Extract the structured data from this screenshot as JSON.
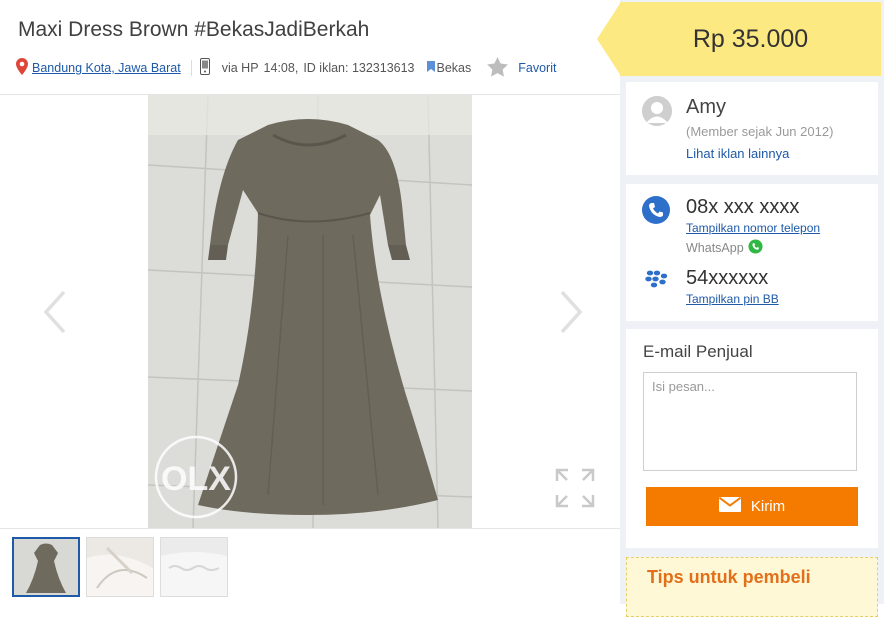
{
  "listing": {
    "title": "Maxi Dress Brown #BekasJadiBerkah",
    "location": "Bandung Kota, Jawa Barat",
    "via": "via HP",
    "time": "14:08,",
    "ad_id": "ID iklan: 132313613",
    "condition": "Bekas",
    "favorite_label": "Favorit"
  },
  "price": "Rp 35.000",
  "seller": {
    "name": "Amy",
    "member_since": "(Member sejak Jun 2012)",
    "other_ads_link": "Lihat iklan lainnya"
  },
  "contact": {
    "phone": "08x xxx xxxx",
    "show_phone": "Tampilkan nomor telepon",
    "whatsapp": "WhatsApp",
    "bb_pin": "54xxxxxx",
    "show_bb": "Tampilkan pin BB"
  },
  "email": {
    "title": "E-mail Penjual",
    "placeholder": "Isi pesan...",
    "value": "",
    "send_label": "Kirim"
  },
  "tips": {
    "title": "Tips untuk pembeli"
  },
  "gallery": {
    "watermark": "OLX",
    "thumbnail_count": 3,
    "active_index": 0
  },
  "colors": {
    "price_bg": "#fde981",
    "accent_blue": "#1e5aa8",
    "send_button": "#f47b00",
    "sidebar_bg": "#eef2f7",
    "tips_title": "#e2701b",
    "whatsapp_green": "#2fb843"
  },
  "icons": {
    "location": "map-pin-icon",
    "device": "mobile-phone-icon",
    "condition": "bookmark-icon",
    "favorite": "star-icon",
    "prev": "chevron-left-icon",
    "next": "chevron-right-icon",
    "fullscreen": "expand-icon",
    "phone": "phone-icon",
    "whatsapp": "whatsapp-icon",
    "blackberry": "blackberry-icon",
    "send": "envelope-icon",
    "avatar": "user-avatar-icon"
  }
}
